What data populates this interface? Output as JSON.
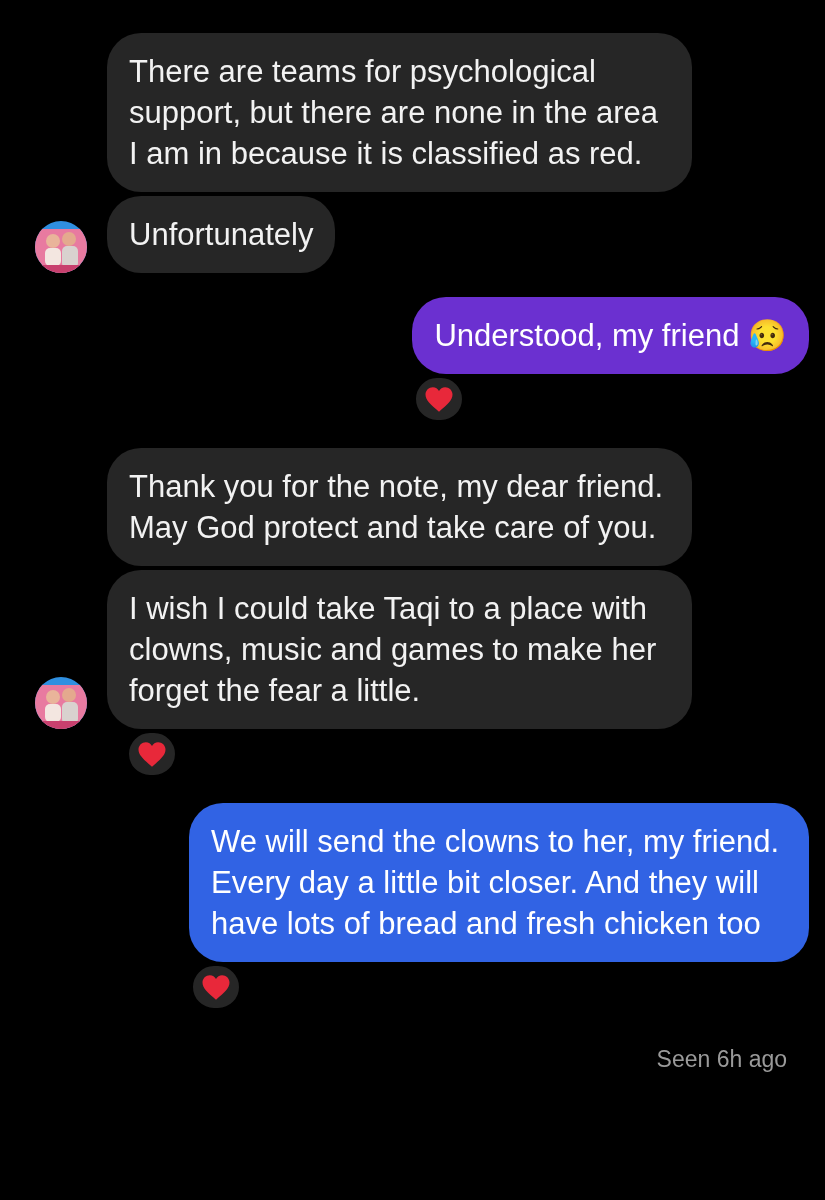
{
  "groups": [
    {
      "kind": "incoming",
      "messages": [
        {
          "text": "There are teams for psychological support, but there are none in the area I am in because it is classified as red.",
          "reaction": false
        },
        {
          "text": "Unfortunately",
          "reaction": false
        }
      ]
    },
    {
      "kind": "outgoing",
      "messages": [
        {
          "text": "Understood, my friend 😥",
          "reaction": true,
          "color": "#6b30d0"
        }
      ]
    },
    {
      "kind": "incoming",
      "messages": [
        {
          "text": "Thank you for the note, my dear friend. May God protect and take care of you.",
          "reaction": false
        },
        {
          "text": "I wish I could take Taqi to a place with clowns, music and games to make her forget the fear a little.",
          "reaction": true
        }
      ]
    },
    {
      "kind": "outgoing",
      "messages": [
        {
          "text": "We will send the clowns to her, my friend. Every day a little bit closer. And they will have lots of bread and fresh chicken too",
          "reaction": true,
          "color": "#3163e4"
        }
      ]
    }
  ],
  "status": "Seen 6h ago"
}
